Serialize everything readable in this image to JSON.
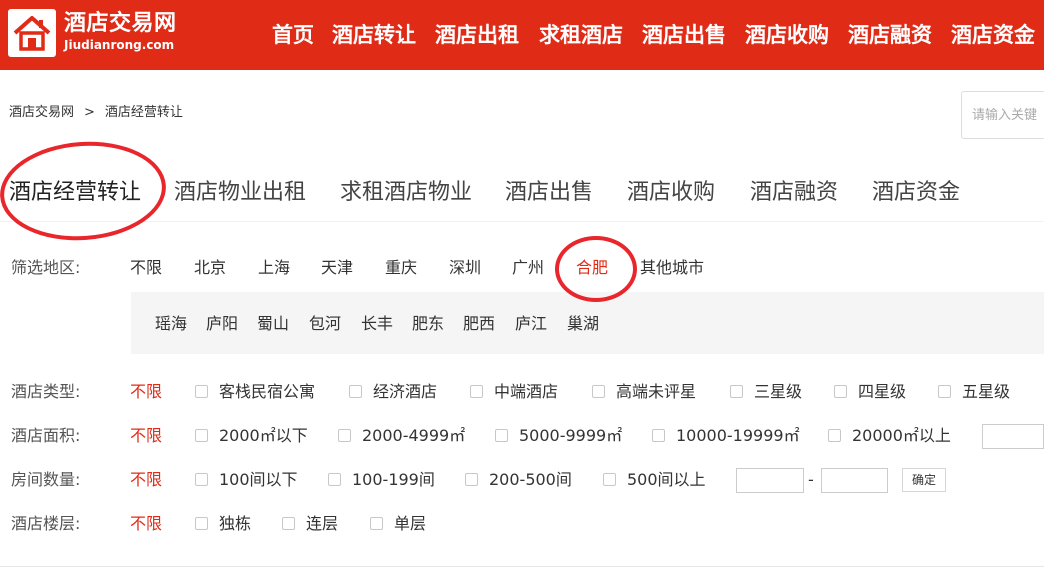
{
  "header": {
    "brand": "酒店交易网",
    "brand_sub": "Jiudianrong.com",
    "nav": [
      "首页",
      "酒店转让",
      "酒店出租",
      "求租酒店",
      "酒店出售",
      "酒店收购",
      "酒店融资",
      "酒店资金"
    ]
  },
  "breadcrumb": {
    "home": "酒店交易网",
    "sep": ">",
    "current": "酒店经营转让"
  },
  "search": {
    "placeholder": "请输入关键"
  },
  "tabs": [
    "酒店经营转让",
    "酒店物业出租",
    "求租酒店物业",
    "酒店出售",
    "酒店收购",
    "酒店融资",
    "酒店资金"
  ],
  "region": {
    "label": "筛选地区:",
    "items": [
      "不限",
      "北京",
      "上海",
      "天津",
      "重庆",
      "深圳",
      "广州",
      "合肥",
      "其他城市"
    ],
    "active": "合肥",
    "sub_items": [
      "瑶海",
      "庐阳",
      "蜀山",
      "包河",
      "长丰",
      "肥东",
      "肥西",
      "庐江",
      "巢湖"
    ]
  },
  "filters": {
    "type": {
      "label": "酒店类型:",
      "unlimited": "不限",
      "options": [
        "客栈民宿公寓",
        "经济酒店",
        "中端酒店",
        "高端未评星",
        "三星级",
        "四星级",
        "五星级"
      ]
    },
    "area": {
      "label": "酒店面积:",
      "unlimited": "不限",
      "options": [
        "2000㎡以下",
        "2000-4999㎡",
        "5000-9999㎡",
        "10000-19999㎡",
        "20000㎡以上"
      ]
    },
    "rooms": {
      "label": "房间数量:",
      "unlimited": "不限",
      "options": [
        "100间以下",
        "100-199间",
        "200-500间",
        "500间以上"
      ],
      "range_sep": "-",
      "confirm": "确定"
    },
    "floors": {
      "label": "酒店楼层:",
      "unlimited": "不限",
      "options": [
        "独栋",
        "连层",
        "单层"
      ]
    }
  },
  "colors": {
    "brand_red": "#e02b17",
    "annotation_red": "#e8262b"
  }
}
